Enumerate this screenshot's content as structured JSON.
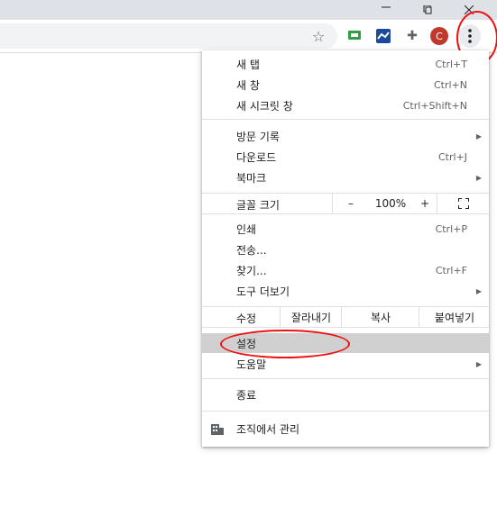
{
  "menu": {
    "new_tab": {
      "label": "새 탭",
      "shortcut": "Ctrl+T"
    },
    "new_window": {
      "label": "새 창",
      "shortcut": "Ctrl+N"
    },
    "incognito": {
      "label": "새 시크릿 창",
      "shortcut": "Ctrl+Shift+N"
    },
    "history": {
      "label": "방문 기록"
    },
    "downloads": {
      "label": "다운로드",
      "shortcut": "Ctrl+J"
    },
    "bookmarks": {
      "label": "북마크"
    },
    "zoom": {
      "label": "글꼴 크기",
      "minus": "–",
      "value": "100%",
      "plus": "+"
    },
    "print": {
      "label": "인쇄",
      "shortcut": "Ctrl+P"
    },
    "cast": {
      "label": "전송..."
    },
    "find": {
      "label": "찾기...",
      "shortcut": "Ctrl+F"
    },
    "more_tools": {
      "label": "도구 더보기"
    },
    "edit": {
      "label": "수정",
      "cut": "잘라내기",
      "copy": "복사",
      "paste": "붙여넣기"
    },
    "settings": {
      "label": "설정"
    },
    "help": {
      "label": "도움말"
    },
    "exit": {
      "label": "종료"
    },
    "managed": {
      "label": "조직에서 관리"
    }
  },
  "toolbar": {
    "avatar_letter": "C"
  }
}
